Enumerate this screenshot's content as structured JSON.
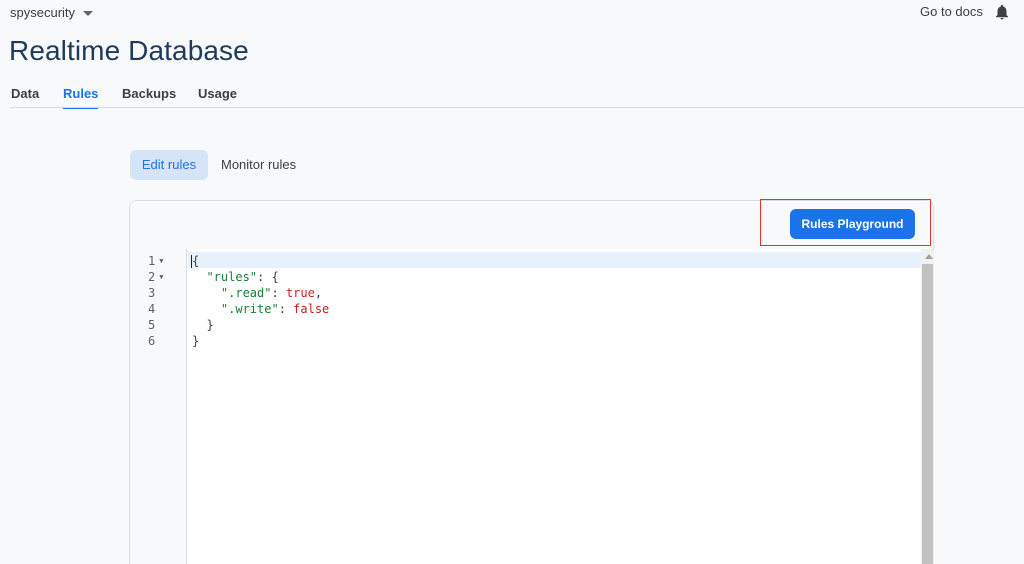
{
  "header": {
    "project_name": "spysecurity",
    "docs_link": "Go to docs",
    "page_title": "Realtime Database"
  },
  "tabs": [
    {
      "label": "Data",
      "active": false
    },
    {
      "label": "Rules",
      "active": true
    },
    {
      "label": "Backups",
      "active": false
    },
    {
      "label": "Usage",
      "active": false
    }
  ],
  "subtabs": [
    {
      "label": "Edit rules",
      "active": true
    },
    {
      "label": "Monitor rules",
      "active": false
    }
  ],
  "toolbar": {
    "playground_label": "Rules Playground"
  },
  "editor": {
    "line_numbers": [
      "1",
      "2",
      "3",
      "4",
      "5",
      "6"
    ],
    "lines": {
      "l1_brace": "{",
      "l2_key": "\"rules\"",
      "l2_rest": ": {",
      "l3_key": "\".read\"",
      "l3_sep": ": ",
      "l3_val": "true",
      "l3_end": ",",
      "l4_key": "\".write\"",
      "l4_sep": ": ",
      "l4_val": "false",
      "l5_brace": "}",
      "l6_brace": "}"
    }
  },
  "icons": {
    "bell": "bell-icon",
    "project_caret": "caret-down-icon",
    "fold": "fold-arrow-icon"
  },
  "colors": {
    "accent": "#1a73e8",
    "title": "#1f3a5a",
    "highlight": "#e8302f",
    "string": "#188038",
    "boolean": "#c5221f"
  }
}
